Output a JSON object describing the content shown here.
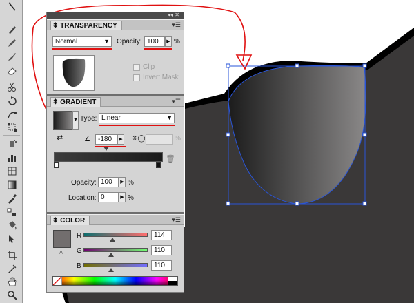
{
  "colors": {
    "panel_bg": "#d4d4d4",
    "highlight_red": "#e01010",
    "path_blue": "#2a55d8",
    "shape_dark": "#3a3838",
    "color_swatch": "#726e6e"
  },
  "transparency": {
    "title": "TRANSPARENCY",
    "blend_mode": "Normal",
    "opacity_label": "Opacity:",
    "opacity_value": "100",
    "opacity_unit": "%",
    "clip_label": "Clip",
    "invert_mask_label": "Invert Mask"
  },
  "gradient": {
    "title": "GRADIENT",
    "type_label": "Type:",
    "type_value": "Linear",
    "angle_value": "-180",
    "aspect_unit": "%",
    "opacity_label": "Opacity:",
    "opacity_value": "100",
    "location_label": "Location:",
    "location_value": "0",
    "percent": "%"
  },
  "color": {
    "title": "COLOR",
    "channels": [
      {
        "label": "R",
        "value": "114",
        "level": 0.447
      },
      {
        "label": "G",
        "value": "110",
        "level": 0.431
      },
      {
        "label": "B",
        "value": "110",
        "level": 0.431
      }
    ]
  },
  "toolbar": {
    "tools": [
      "direct-selection",
      "pen",
      "pencil",
      "brush",
      "blob-brush",
      "eraser",
      "scissors",
      "rotate",
      "scale",
      "warp",
      "free-transform",
      "symbol-sprayer",
      "graph",
      "mesh",
      "gradient",
      "eyedropper",
      "blend",
      "live-paint",
      "live-paint-selection",
      "crop",
      "slice",
      "hand",
      "zoom"
    ]
  }
}
